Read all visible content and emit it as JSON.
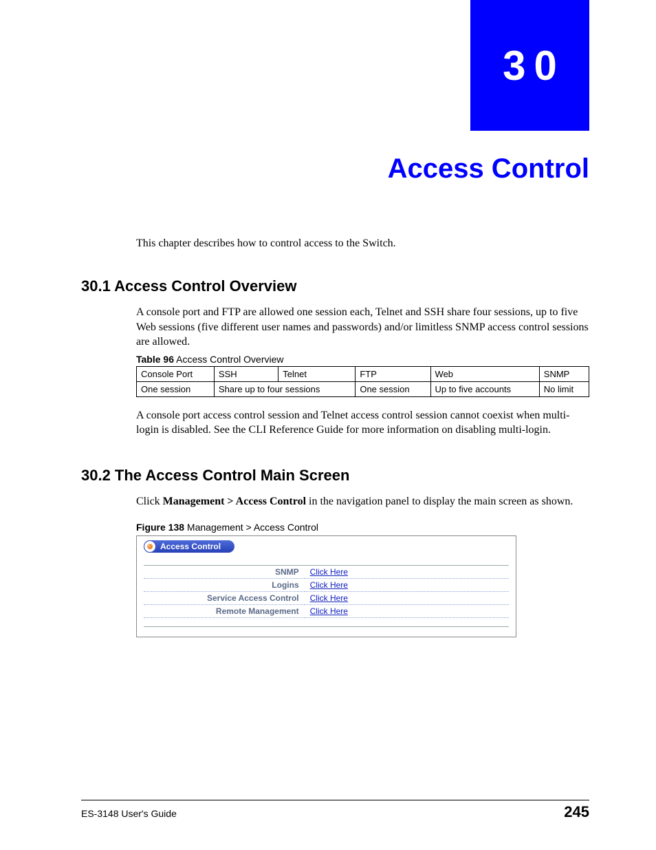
{
  "chapter": {
    "number": "30",
    "title": "Access Control",
    "intro": "This chapter describes how to control access to the Switch."
  },
  "section1": {
    "heading": "30.1  Access Control Overview",
    "para1": "A console port and FTP are allowed one session each, Telnet and SSH share four sessions, up to five Web sessions (five different user names and passwords) and/or limitless SNMP access control sessions are allowed.",
    "table_caption_bold": "Table 96",
    "table_caption_rest": "   Access Control Overview",
    "table": {
      "headers": [
        "Console Port",
        "SSH",
        "Telnet",
        "FTP",
        "Web",
        "SNMP"
      ],
      "row": [
        "One session",
        "Share up to four sessions",
        "One session",
        "Up to five accounts",
        "No limit"
      ]
    },
    "para2": "A console port access control session and Telnet access control session cannot coexist when multi-login is disabled. See the CLI Reference Guide for more information on disabling multi-login."
  },
  "section2": {
    "heading": "30.2  The Access Control Main Screen",
    "click_pre": "Click ",
    "click_bold": "Management > Access Control",
    "click_post": " in the navigation panel to display the main screen as shown.",
    "figure_caption_bold": "Figure 138",
    "figure_caption_rest": "   Management > Access Control",
    "pill_label": "Access Control",
    "rows": [
      {
        "label": "SNMP",
        "link": "Click Here"
      },
      {
        "label": "Logins",
        "link": "Click Here"
      },
      {
        "label": "Service Access Control",
        "link": "Click Here"
      },
      {
        "label": "Remote Management",
        "link": "Click Here"
      }
    ]
  },
  "footer": {
    "guide": "ES-3148 User's Guide",
    "page": "245"
  }
}
